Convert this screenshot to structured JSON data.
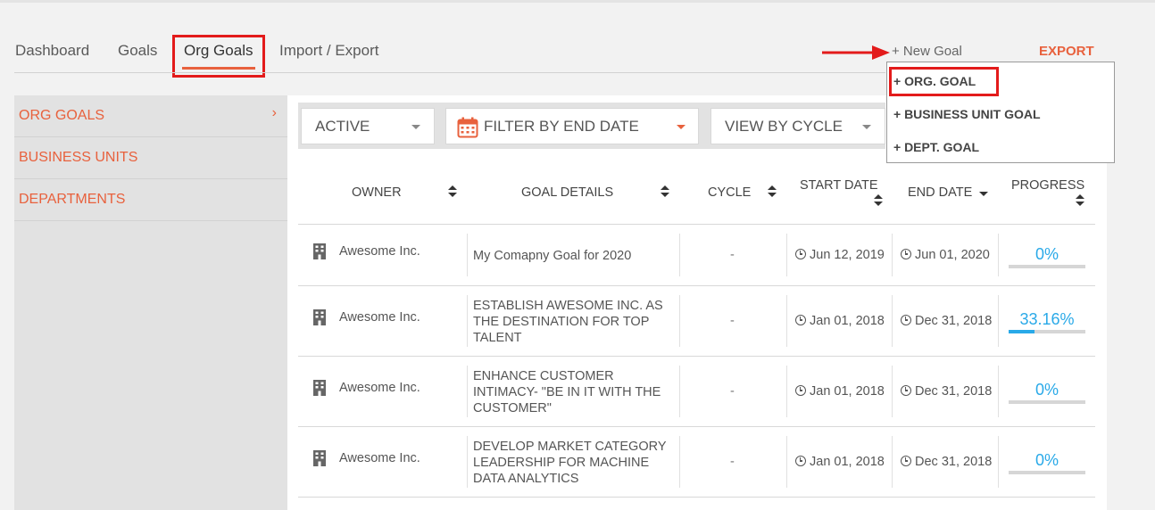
{
  "tabs": [
    {
      "label": "Dashboard"
    },
    {
      "label": "Goals"
    },
    {
      "label": "Org Goals",
      "active": true
    },
    {
      "label": "Import / Export"
    }
  ],
  "header": {
    "new_goal_label": "+ New Goal",
    "export_label": "EXPORT"
  },
  "new_goal_menu": [
    {
      "label": "+ ORG. GOAL",
      "highlighted": true
    },
    {
      "label": "+ BUSINESS UNIT GOAL"
    },
    {
      "label": "+ DEPT. GOAL"
    }
  ],
  "sidebar": {
    "items": [
      {
        "label": "ORG GOALS",
        "active": true,
        "chevron": "›"
      },
      {
        "label": "BUSINESS UNITS"
      },
      {
        "label": "DEPARTMENTS"
      }
    ]
  },
  "filters": {
    "status": "ACTIVE",
    "end_date": "FILTER BY END DATE",
    "cycle": "VIEW BY CYCLE"
  },
  "table": {
    "columns": {
      "owner": "OWNER",
      "goal_details": "GOAL DETAILS",
      "cycle": "CYCLE",
      "start_date": "START DATE",
      "end_date": "END DATE",
      "progress": "PROGRESS"
    },
    "rows": [
      {
        "owner": "Awesome Inc.",
        "goal": "My Comapny Goal for 2020",
        "cycle": "-",
        "start": "Jun 12, 2019",
        "end": "Jun 01, 2020",
        "progress_label": "0%",
        "progress": 0
      },
      {
        "owner": "Awesome Inc.",
        "goal": "ESTABLISH AWESOME INC. AS THE DESTINATION FOR TOP TALENT",
        "cycle": "-",
        "start": "Jan 01, 2018",
        "end": "Dec 31, 2018",
        "progress_label": "33.16%",
        "progress": 33.16
      },
      {
        "owner": "Awesome Inc.",
        "goal": "ENHANCE CUSTOMER INTIMACY- \"BE IN IT WITH THE CUSTOMER\"",
        "cycle": "-",
        "start": "Jan 01, 2018",
        "end": "Dec 31, 2018",
        "progress_label": "0%",
        "progress": 0
      },
      {
        "owner": "Awesome Inc.",
        "goal": "DEVELOP MARKET CATEGORY LEADERSHIP FOR MACHINE DATA ANALYTICS",
        "cycle": "-",
        "start": "Jan 01, 2018",
        "end": "Dec 31, 2018",
        "progress_label": "0%",
        "progress": 0
      }
    ]
  },
  "colors": {
    "accent": "#e8613d",
    "progress": "#29a9e8",
    "highlight_box": "#e31b1b"
  },
  "icons": {
    "arrow": "red-right-arrow-icon",
    "calendar": "calendar-icon",
    "owner": "building-icon",
    "date": "clock-icon",
    "sort": "sort-icon"
  }
}
